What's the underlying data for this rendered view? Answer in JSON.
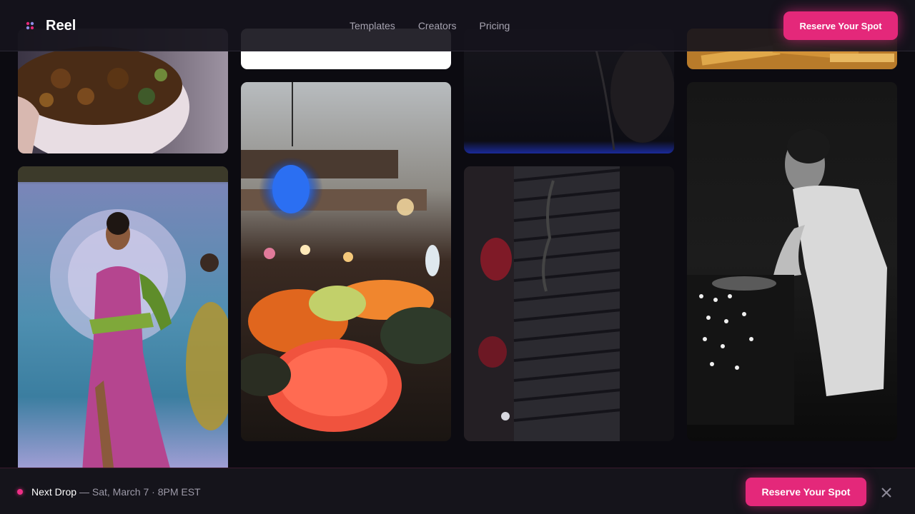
{
  "brand": {
    "name": "Reel",
    "logo_icon": "reel-logo-icon"
  },
  "nav": {
    "links": [
      "Templates",
      "Creators",
      "Pricing"
    ],
    "cta_label": "Reserve Your Spot"
  },
  "gallery": {
    "cards": [
      {
        "name": "food-bowl-photo"
      },
      {
        "name": "fashion-runway-photo"
      },
      {
        "name": "blank-white-card"
      },
      {
        "name": "sushi-restaurant-photo"
      },
      {
        "name": "dark-scene-photo"
      },
      {
        "name": "dark-shutters-photo"
      },
      {
        "name": "fries-photo"
      },
      {
        "name": "dj-mixing-photo"
      }
    ]
  },
  "drop_banner": {
    "label": "Next Drop",
    "date": "— Sat, March 7 · 8PM EST",
    "cta_label": "Reserve Your Spot",
    "close_icon": "close-icon"
  },
  "colors": {
    "accent": "#e4287a",
    "background": "#0c0b11",
    "nav_bg": "#16141c"
  }
}
